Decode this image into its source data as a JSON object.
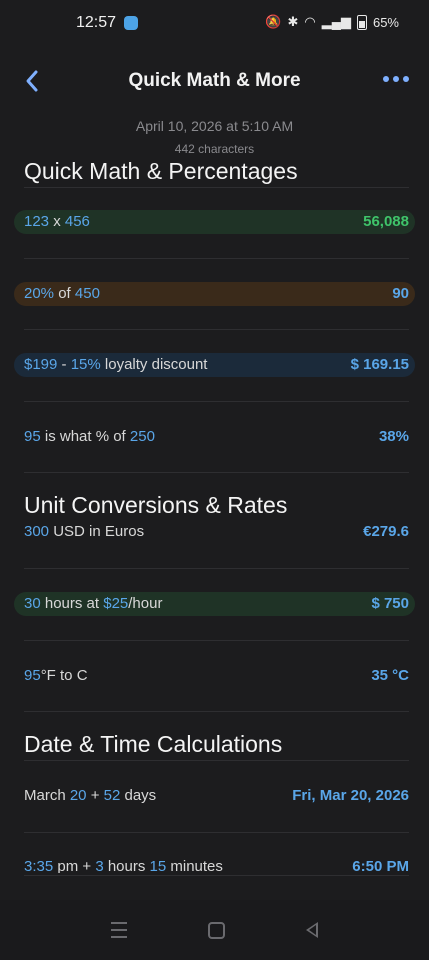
{
  "status": {
    "time": "12:57",
    "battery": "65%",
    "icons": [
      "mute-icon",
      "bluetooth-icon",
      "wifi-icon",
      "volte-icon",
      "signal-icon",
      "battery-icon"
    ]
  },
  "header": {
    "title": "Quick Math & More"
  },
  "meta": {
    "date": "April 10, 2026 at 5:10 AM",
    "chars": "442 characters"
  },
  "sections": {
    "quick": {
      "title": "Quick Math & Percentages"
    },
    "units": {
      "title": "Unit Conversions & Rates"
    },
    "dates": {
      "title": "Date & Time Calculations"
    }
  },
  "rows": {
    "mult": {
      "a": "123",
      "op": " x ",
      "b": "456",
      "result": "56,088"
    },
    "pct": {
      "a": "20%",
      "mid": " of ",
      "b": "450",
      "result": "90"
    },
    "discount": {
      "a": "$199",
      "mid1": " - ",
      "b": "15%",
      "mid2": " loyalty discount",
      "result": "$ 169.15"
    },
    "whatpct": {
      "a": "95",
      "mid": " is what % of ",
      "b": "250",
      "result": "38%"
    },
    "usd": {
      "a": "300",
      "mid": " USD in Euros",
      "result": "€279.6"
    },
    "hours": {
      "a": "30",
      "mid1": " hours at ",
      "b": "$25",
      "mid2": "/hour",
      "result": "$ 750"
    },
    "temp": {
      "a": "95",
      "mid": "°F to C",
      "result": "35 °C"
    },
    "dateadd": {
      "pre": "March ",
      "a": "20",
      "mid": " + ",
      "b": "52",
      "post": " days",
      "result": "Fri, Mar 20, 2026"
    },
    "timeadd": {
      "a": "3:35",
      "mid1": " pm + ",
      "b": "3",
      "mid2": " hours ",
      "c": "15",
      "post": " minutes",
      "result": "6:50 PM"
    }
  },
  "colors": {
    "accent": "#5aa6e8",
    "green": "#3fc46a",
    "background": "#1c1c1e"
  }
}
